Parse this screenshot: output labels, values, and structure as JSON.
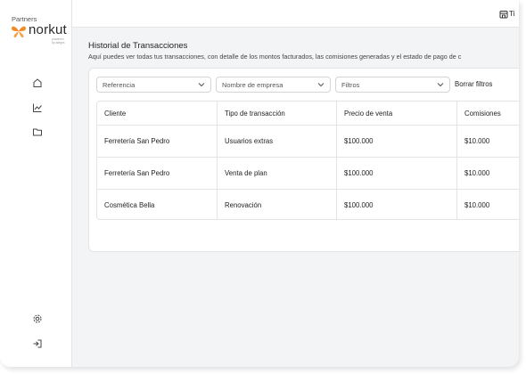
{
  "brand": {
    "tag": "Partners",
    "name": "norkut",
    "sub": "powered by alegra"
  },
  "sidebar": {
    "items": [
      {
        "name": "home-icon"
      },
      {
        "name": "chart-icon"
      },
      {
        "name": "folder-icon"
      }
    ],
    "bottom": [
      {
        "name": "settings-icon"
      },
      {
        "name": "logout-icon"
      }
    ]
  },
  "topbar": {
    "user_label": "Ti"
  },
  "page": {
    "title": "Historial de Transacciones",
    "subtitle": "Aquí puedes ver todas tus transacciones, con detalle de los montos facturados, las comisiones generadas y el estado de pago de c"
  },
  "filters": {
    "referencia": "Referencia",
    "empresa": "Nombre de empresa",
    "filtros": "Filtros",
    "clear": "Borrar filtros"
  },
  "table": {
    "headers": [
      "Cliente",
      "Tipo de transacción",
      "Precio de venta",
      "Comisiones"
    ],
    "rows": [
      [
        "Ferretería San Pedro",
        "Usuarios extras",
        "$100.000",
        "$10.000"
      ],
      [
        "Ferretería San Pedro",
        "Venta de plan",
        "$100.000",
        "$10.000"
      ],
      [
        "Cosmética Bella",
        "Renovación",
        "$100.000",
        "$10.000"
      ]
    ]
  },
  "colors": {
    "brand_orange": "#f28c28",
    "background": "#f3f4f6",
    "border": "#e4e4e7"
  }
}
